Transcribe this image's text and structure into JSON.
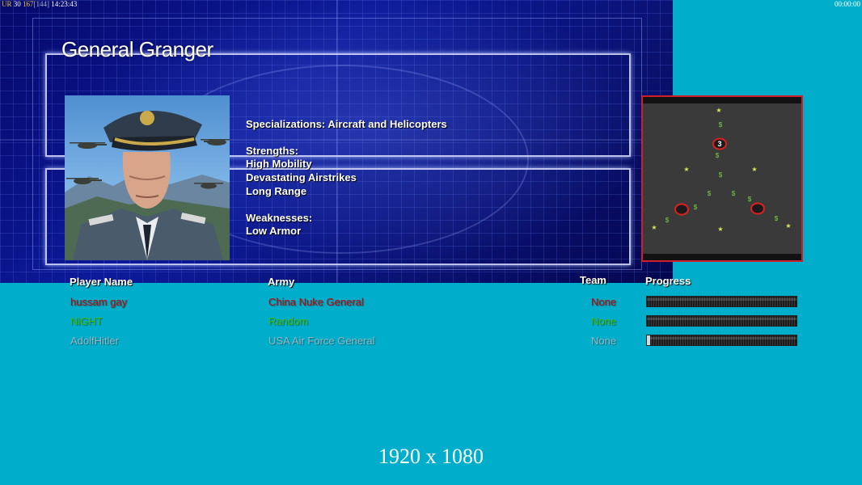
{
  "hud": {
    "left_label": "UR",
    "left_value": "30",
    "frame_value": "167",
    "frame_bracket": "[144]",
    "clock": "14:23:43",
    "timer": "00:00:00"
  },
  "briefing": {
    "general_name": "General Granger",
    "specializations": "Specializations: Aircraft and Helicopters",
    "strengths_label": "Strengths:",
    "strengths": [
      "High Mobility",
      "Devastating Airstrikes",
      "Long Range"
    ],
    "weaknesses_label": "Weaknesses:",
    "weaknesses": [
      "Low Armor"
    ]
  },
  "minimap": {
    "start_label": "3"
  },
  "table": {
    "headers": {
      "player_name": "Player Name",
      "army": "Army",
      "team": "Team",
      "progress": "Progress"
    },
    "rows": [
      {
        "name": "hussam gay",
        "army": "China Nuke General",
        "team": "None",
        "color": "#c40000",
        "progress": 1.0
      },
      {
        "name": "NiGHT",
        "army": "Random",
        "team": "None",
        "color": "#47b800",
        "progress": 1.0
      },
      {
        "name": "AdolfHitler",
        "army": "USA Air Force General",
        "team": "None",
        "color": "#9cb4c0",
        "progress": 0.02
      }
    ]
  },
  "footer": {
    "resolution": "1920 x 1080"
  }
}
